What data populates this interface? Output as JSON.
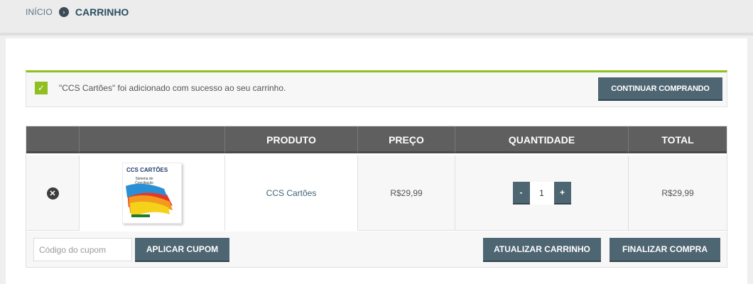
{
  "breadcrumb": {
    "home": "INÍCIO",
    "separator": "›",
    "current": "CARRINHO"
  },
  "notice": {
    "check": "✓",
    "message": "\"CCS Cartões\" foi adicionado com sucesso ao seu carrinho.",
    "continue_label": "CONTINUAR COMPRANDO"
  },
  "cart": {
    "headers": {
      "remove": "",
      "thumbnail": "",
      "product": "PRODUTO",
      "price": "PREÇO",
      "quantity": "QUANTIDADE",
      "total": "TOTAL"
    },
    "items": [
      {
        "remove_glyph": "✕",
        "thumb_title": "CCS CARTÕES",
        "thumb_subtitle": "Sistema de Conciliação",
        "product_name": "CCS Cartões",
        "price": "R$29,99",
        "quantity": "1",
        "minus": "-",
        "plus": "+",
        "total": "R$29,99"
      }
    ],
    "coupon_placeholder": "Código do cupom",
    "apply_coupon_label": "APLICAR CUPOM",
    "update_cart_label": "ATUALIZAR CARRINHO",
    "checkout_label": "FINALIZAR COMPRA"
  },
  "colors": {
    "accent": "#8fbf21",
    "button": "#4e6572",
    "table_header": "#5f5f5f"
  }
}
